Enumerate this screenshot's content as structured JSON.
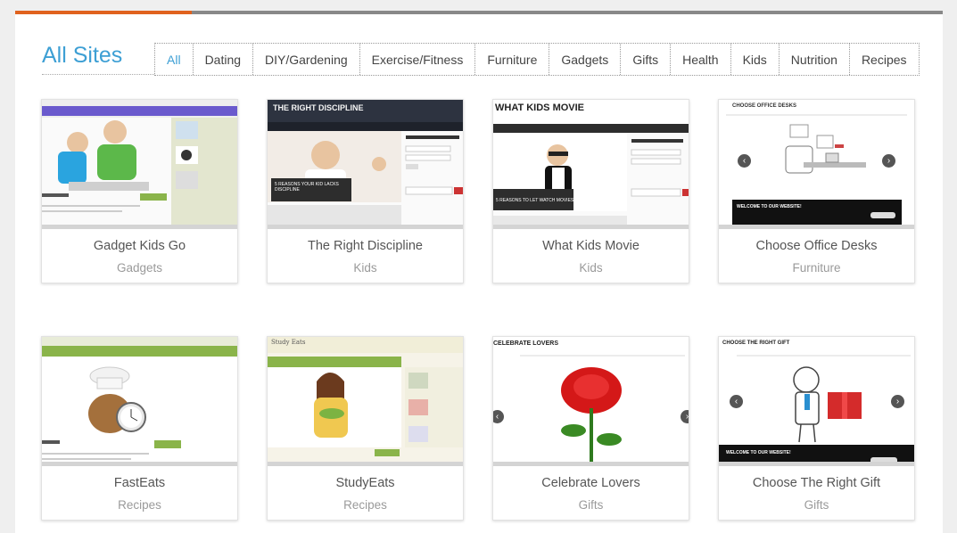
{
  "page": {
    "title": "All Sites",
    "progress": 0.19,
    "accent_color": "#3d9fd4",
    "progress_color": "#e0621e"
  },
  "filters": [
    "All",
    "Dating",
    "DIY/Gardening",
    "Exercise/Fitness",
    "Furniture",
    "Gadgets",
    "Gifts",
    "Health",
    "Kids",
    "Nutrition",
    "Recipes"
  ],
  "active_filter": "All",
  "sites": [
    {
      "name": "Gadget Kids Go",
      "category": "Gadgets"
    },
    {
      "name": "The Right Discipline",
      "category": "Kids"
    },
    {
      "name": "What Kids Movie",
      "category": "Kids"
    },
    {
      "name": "Choose Office Desks",
      "category": "Furniture"
    },
    {
      "name": "FastEats",
      "category": "Recipes"
    },
    {
      "name": "StudyEats",
      "category": "Recipes"
    },
    {
      "name": "Celebrate Lovers",
      "category": "Gifts"
    },
    {
      "name": "Choose The Right Gift",
      "category": "Gifts"
    }
  ],
  "thumbs": {
    "t2_header": "THE RIGHT DISCIPLINE",
    "t2_overlay": "5 REASONS YOUR KID LACKS DISCIPLINE",
    "t3_header": "WHAT KIDS MOVIE",
    "t3_overlay": "5 REASONS TO LET WATCH MOVIES",
    "t4_header": "CHOOSE OFFICE DESKS",
    "t4_banner": "WELCOME TO OUR WEBSITE!",
    "t6_header": "Study Eats",
    "t7_header": "CELEBRATE LOVERS",
    "t8_header": "CHOOSE THE RIGHT GIFT",
    "t8_banner": "WELCOME TO OUR WEBSITE!"
  }
}
